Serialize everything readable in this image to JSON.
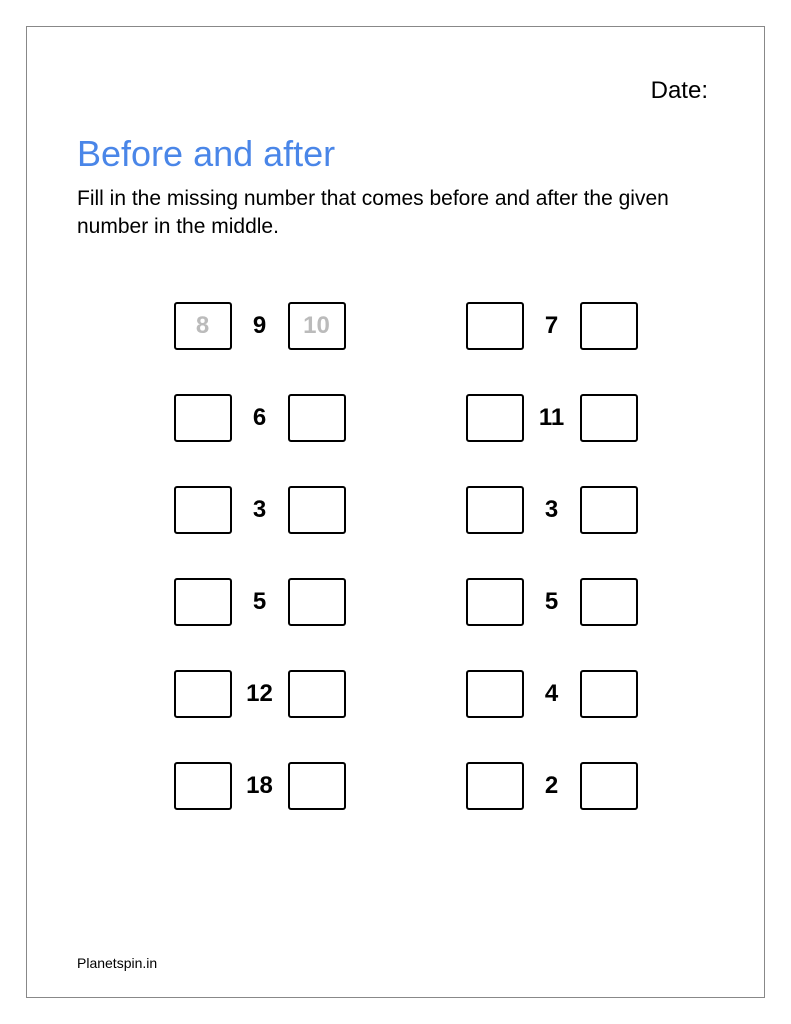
{
  "header": {
    "date_label": "Date:"
  },
  "title": "Before and after",
  "instructions": "Fill in the missing number that comes before and after the given number in the middle.",
  "columns": [
    [
      {
        "before": "8",
        "mid": "9",
        "after": "10"
      },
      {
        "before": "",
        "mid": "6",
        "after": ""
      },
      {
        "before": "",
        "mid": "3",
        "after": ""
      },
      {
        "before": "",
        "mid": "5",
        "after": ""
      },
      {
        "before": "",
        "mid": "12",
        "after": ""
      },
      {
        "before": "",
        "mid": "18",
        "after": ""
      }
    ],
    [
      {
        "before": "",
        "mid": "7",
        "after": ""
      },
      {
        "before": "",
        "mid": "11",
        "after": ""
      },
      {
        "before": "",
        "mid": "3",
        "after": ""
      },
      {
        "before": "",
        "mid": "5",
        "after": ""
      },
      {
        "before": "",
        "mid": "4",
        "after": ""
      },
      {
        "before": "",
        "mid": "2",
        "after": ""
      }
    ]
  ],
  "footer": "Planetspin.in"
}
